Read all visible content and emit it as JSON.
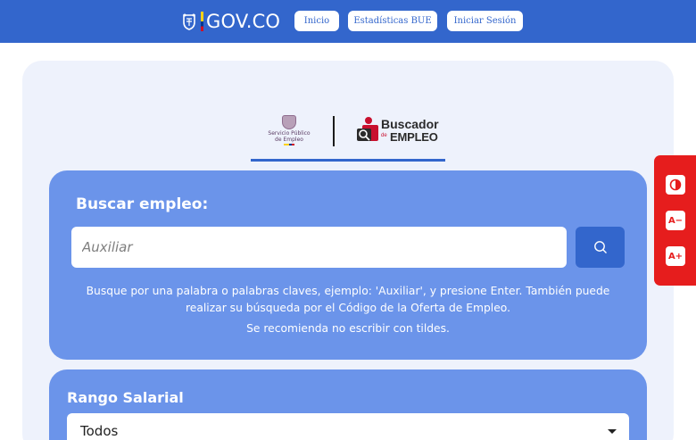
{
  "header": {
    "logo_text": "GOV.CO",
    "nav": [
      {
        "label": "Inicio"
      },
      {
        "label": "Estadísticas BUE"
      },
      {
        "label": "Iniciar Sesión"
      }
    ]
  },
  "branding": {
    "spe_line1": "Servicio Público",
    "spe_line2": "de Empleo",
    "buscador_line1": "Buscador",
    "buscador_de": "de",
    "buscador_line2": "EMPLEO"
  },
  "search": {
    "title": "Buscar empleo:",
    "placeholder": "Auxiliar",
    "help_text": "Busque por una palabra o palabras claves, ejemplo: 'Auxiliar', y presione Enter. También puede realizar su búsqueda por el Código de la Oferta de Empleo.",
    "tip_text": "Se recomienda no escribir con tildes."
  },
  "salary": {
    "title": "Rango Salarial",
    "selected": "Todos"
  },
  "accessibility": {
    "buttons": [
      {
        "icon": "contrast-icon"
      },
      {
        "label": "A−"
      },
      {
        "label": "A+"
      }
    ]
  },
  "colors": {
    "brand_blue": "#3366cc",
    "panel_blue": "#6b94ea",
    "a11y_red": "#e61d1d"
  }
}
